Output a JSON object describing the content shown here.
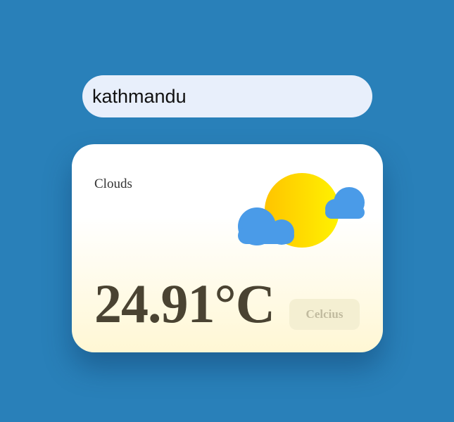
{
  "search": {
    "value": "kathmandu"
  },
  "weather": {
    "condition": "Clouds",
    "temperature": "24.91°C",
    "unit_button_label": "Celcius",
    "icon": "sun-behind-clouds-icon"
  },
  "colors": {
    "background": "#2980b9",
    "search_bg": "#e8effb",
    "sun": "#ffd400",
    "cloud": "#4a9be8",
    "temperature_text": "#4a4332"
  }
}
